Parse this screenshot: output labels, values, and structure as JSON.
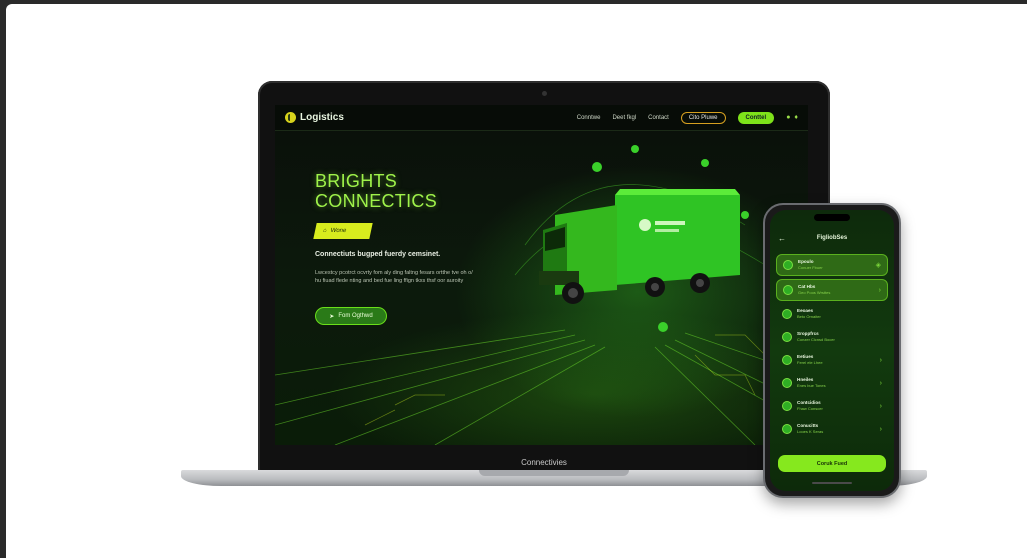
{
  "laptop": {
    "brand": "Logistics",
    "nav": {
      "links": [
        "Conntwe",
        "Deet fkgl",
        "Contact"
      ],
      "outline_button": "Cito Pluwe",
      "cta_button": "Conttel"
    },
    "hero": {
      "title_line1": "BRIGHTS",
      "title_line2": "CONNECTICS",
      "badge": "Wone",
      "subtitle": "Connectiuts bugped fuerdy cemsinet.",
      "body": "Lwcestcy pcotrct ocvrty fom aly ding faltng fesars ortthe tve oh o/ hu fiuad flede nting and bed fue ling ffign tkxs thsf oor auroity",
      "button": "Fom Ogthwd"
    },
    "base_label": "Connectivies"
  },
  "phone": {
    "title": "FigliobSes",
    "items": [
      {
        "title": "Epoulo",
        "sub": "Conuer Fbuer",
        "highlight": true
      },
      {
        "title": "Cat Hbs",
        "sub": "Geo Poos Wrsttes",
        "highlight": true
      },
      {
        "title": "Eeoaes",
        "sub": "Beto Ornaiter",
        "highlight": false
      },
      {
        "title": "Sroppfrcs",
        "sub": "Conzer Clcnsd Bocer",
        "highlight": false
      },
      {
        "title": "Eetiues",
        "sub": "Ferel ele Lhee",
        "highlight": false
      },
      {
        "title": "Hneiles",
        "sub": "Enes bue Tones",
        "highlight": false
      },
      {
        "title": "Contcidios",
        "sub": "Fhaw Conscer",
        "highlight": false
      },
      {
        "title": "Conucitts",
        "sub": "Looes K Seras",
        "highlight": false
      }
    ],
    "cta": "Coruk Fued"
  },
  "colors": {
    "accent": "#7ee21a",
    "hero_text": "#9ff24a",
    "badge": "#d8ec1e"
  }
}
